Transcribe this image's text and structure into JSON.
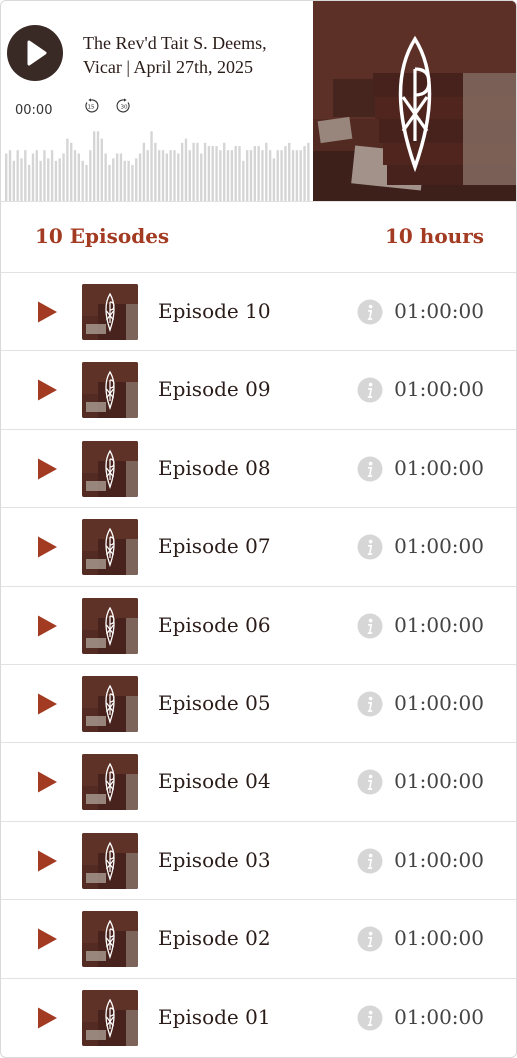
{
  "player": {
    "title": "The Rev'd Tait S. Deems, Vicar | April 27th, 2025",
    "current_time": "00:00",
    "skip_back_label": "15",
    "skip_forward_label": "30",
    "waveform_levels": [
      0.58,
      0.62,
      0.49,
      0.62,
      0.52,
      0.62,
      0.44,
      0.58,
      0.62,
      0.49,
      0.62,
      0.52,
      0.62,
      0.49,
      0.52,
      0.58,
      0.76,
      0.71,
      0.62,
      0.58,
      0.49,
      0.44,
      0.62,
      0.85,
      0.85,
      0.76,
      0.58,
      0.44,
      0.52,
      0.58,
      0.58,
      0.49,
      0.49,
      0.44,
      0.52,
      0.58,
      0.71,
      0.62,
      0.85,
      0.71,
      0.62,
      0.62,
      0.58,
      0.62,
      0.62,
      0.58,
      0.71,
      0.76,
      0.62,
      0.71,
      0.71,
      0.58,
      0.71,
      0.67,
      0.67,
      0.67,
      0.62,
      0.71,
      0.62,
      0.62,
      0.67,
      0.67,
      0.49,
      0.62,
      0.62,
      0.67,
      0.67,
      0.62,
      0.71,
      0.62,
      0.52,
      0.62,
      0.62,
      0.67,
      0.71,
      0.62,
      0.62,
      0.62,
      0.67,
      0.71
    ],
    "colors": {
      "play_bg": "#3a2a25",
      "wave": "#d5d5d5"
    }
  },
  "summary": {
    "episodes_label": "10 Episodes",
    "duration_label": "10 hours",
    "accent": "#a33a22"
  },
  "episodes": [
    {
      "title": "Episode 10",
      "duration": "01:00:00"
    },
    {
      "title": "Episode 09",
      "duration": "01:00:00"
    },
    {
      "title": "Episode 08",
      "duration": "01:00:00"
    },
    {
      "title": "Episode 07",
      "duration": "01:00:00"
    },
    {
      "title": "Episode 06",
      "duration": "01:00:00"
    },
    {
      "title": "Episode 05",
      "duration": "01:00:00"
    },
    {
      "title": "Episode 04",
      "duration": "01:00:00"
    },
    {
      "title": "Episode 03",
      "duration": "01:00:00"
    },
    {
      "title": "Episode 02",
      "duration": "01:00:00"
    },
    {
      "title": "Episode 01",
      "duration": "01:00:00"
    }
  ],
  "icons": {
    "player_play": "play-icon",
    "skip_back": "rewind-15-icon",
    "skip_forward": "forward-30-icon",
    "episode_play": "play-triangle-icon",
    "info": "info-icon",
    "artwork_symbol": "chi-rho-icon"
  }
}
